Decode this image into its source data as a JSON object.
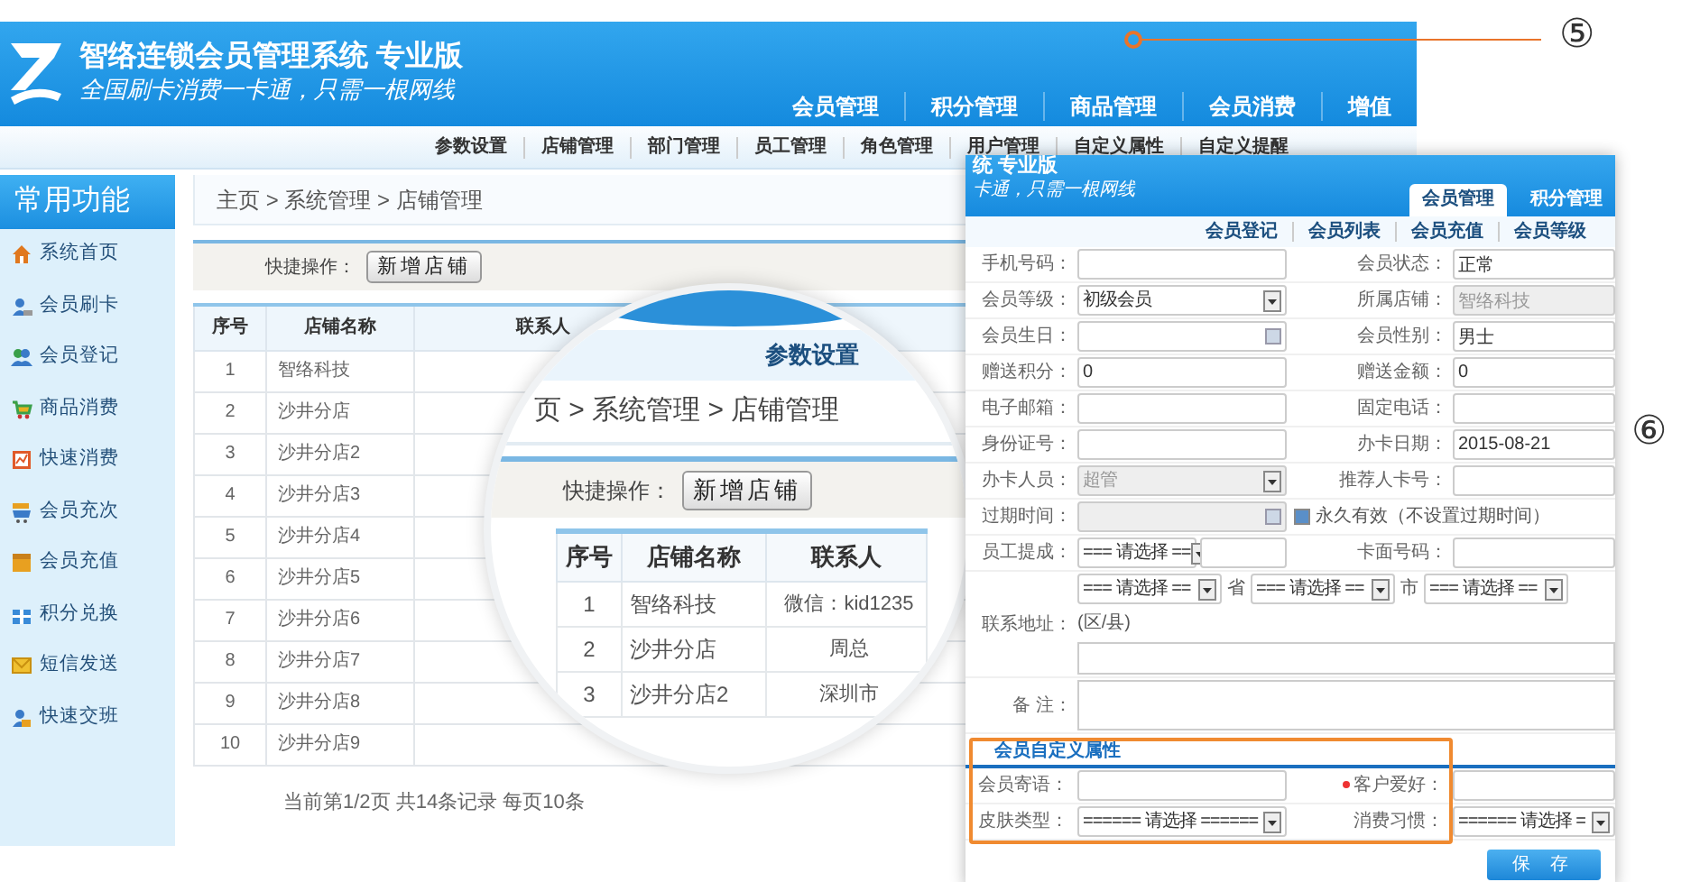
{
  "header": {
    "title": "智络连锁会员管理系统 专业版",
    "slogan": "全国刷卡消费一卡通，只需一根网线",
    "nav": [
      "会员管理",
      "积分管理",
      "商品管理",
      "会员消费",
      "增值"
    ]
  },
  "sub_nav": [
    "参数设置",
    "店铺管理",
    "部门管理",
    "员工管理",
    "角色管理",
    "用户管理",
    "自定义属性",
    "自定义提醒"
  ],
  "sidebar": {
    "title": "常用功能",
    "items": [
      "系统首页",
      "会员刷卡",
      "会员登记",
      "商品消费",
      "快速消费",
      "会员充次",
      "会员充值",
      "积分兑换",
      "短信发送",
      "快速交班"
    ]
  },
  "breadcrumb": "主页 > 系统管理 > 店铺管理",
  "quick_actions": {
    "label": "快捷操作：",
    "button": "新增店铺"
  },
  "table": {
    "columns": [
      "序号",
      "店铺名称",
      "联系人"
    ],
    "rows": [
      [
        "1",
        "智络科技"
      ],
      [
        "2",
        "沙井分店"
      ],
      [
        "3",
        "沙井分店2"
      ],
      [
        "4",
        "沙井分店3"
      ],
      [
        "5",
        "沙井分店4"
      ],
      [
        "6",
        "沙井分店5"
      ],
      [
        "7",
        "沙井分店6"
      ],
      [
        "8",
        "沙井分店7"
      ],
      [
        "9",
        "沙井分店8"
      ],
      [
        "10",
        "沙井分店9"
      ]
    ]
  },
  "pagination": "当前第1/2页 共14条记录 每页10条",
  "magnifier": {
    "tab": "参数设置",
    "breadcrumb": "页 > 系统管理 > 店铺管理",
    "quick_actions": {
      "label": "快捷操作：",
      "button": "新增店铺"
    },
    "table": {
      "columns": [
        "序号",
        "店铺名称",
        "联系人"
      ],
      "rows": [
        [
          "1",
          "智络科技",
          "微信：kid1235"
        ],
        [
          "2",
          "沙井分店",
          "周总"
        ],
        [
          "3",
          "沙井分店2",
          "深圳市"
        ]
      ]
    }
  },
  "member_form": {
    "title": "统 专业版",
    "slogan": "卡通，只需一根网线",
    "tabs": [
      {
        "label": "会员管理",
        "selected": true
      },
      {
        "label": "积分管理",
        "selected": false
      }
    ],
    "sub_nav": [
      "会员登记",
      "会员列表",
      "会员充值",
      "会员等级"
    ],
    "rows": [
      {
        "kind": "pair",
        "fields": [
          {
            "label": "手机号码：",
            "kind": "text",
            "disabled": false
          },
          {
            "label": "会员状态：",
            "kind": "text",
            "value": "正常",
            "disabled": false
          }
        ]
      },
      {
        "kind": "pair",
        "fields": [
          {
            "label": "会员等级：",
            "kind": "select",
            "value": "初级会员",
            "disabled": false
          },
          {
            "label": "所属店铺：",
            "kind": "text",
            "value": "智络科技",
            "disabled": true
          }
        ]
      },
      {
        "kind": "pair",
        "fields": [
          {
            "label": "会员生日：",
            "kind": "date",
            "disabled": false
          },
          {
            "label": "会员性别：",
            "kind": "text",
            "value": "男士",
            "disabled": false
          }
        ]
      },
      {
        "kind": "pair",
        "fields": [
          {
            "label": "赠送积分：",
            "kind": "text",
            "value": "0",
            "disabled": false
          },
          {
            "label": "赠送金额：",
            "kind": "text",
            "value": "0",
            "disabled": false
          }
        ]
      },
      {
        "kind": "pair",
        "fields": [
          {
            "label": "电子邮箱：",
            "kind": "text",
            "disabled": false
          },
          {
            "label": "固定电话：",
            "kind": "text",
            "disabled": false
          }
        ]
      },
      {
        "kind": "pair",
        "fields": [
          {
            "label": "身份证号：",
            "kind": "text",
            "disabled": false
          },
          {
            "label": "办卡日期：",
            "kind": "text",
            "value": "2015-08-21",
            "disabled": false
          }
        ]
      },
      {
        "kind": "pair",
        "fields": [
          {
            "label": "办卡人员：",
            "kind": "select",
            "value": "超管",
            "disabled": true
          },
          {
            "label": "推荐人卡号：",
            "kind": "text",
            "disabled": false
          }
        ]
      },
      {
        "kind": "expiry",
        "label": "过期时间：",
        "disabled": true,
        "checkbox": {
          "label": "永久有效（不设置过期时间）",
          "checked": true
        }
      },
      {
        "kind": "pair",
        "fields": [
          {
            "label": "员工提成：",
            "kind": "select-text",
            "value": "=== 请选择 ==",
            "disabled": false
          },
          {
            "label": "卡面号码：",
            "kind": "text",
            "disabled": false
          }
        ]
      },
      {
        "kind": "address",
        "label": "联系地址：",
        "selects": [
          {
            "value": "=== 请选择 ==",
            "suffix": "省"
          },
          {
            "value": "=== 请选择 ==",
            "suffix": "市"
          },
          {
            "value": "=== 请选择 ==",
            "suffix": "(区/县)"
          }
        ]
      },
      {
        "kind": "remark",
        "label": "备 注："
      }
    ],
    "custom_section": {
      "title": "会员自定义属性",
      "rows": [
        {
          "kind": "pair",
          "fields": [
            {
              "label": "会员寄语：",
              "kind": "text",
              "disabled": false
            },
            {
              "label": "客户爱好：",
              "kind": "text",
              "required": true,
              "disabled": false
            }
          ]
        },
        {
          "kind": "pair",
          "fields": [
            {
              "label": "皮肤类型：",
              "kind": "select",
              "value": "====== 请选择 ======",
              "disabled": false
            },
            {
              "label": "消费习惯：",
              "kind": "select",
              "value": "====== 请选择 =",
              "disabled": false
            }
          ]
        }
      ]
    },
    "save_button": "保 存"
  },
  "callouts": [
    "⑤",
    "⑥"
  ]
}
